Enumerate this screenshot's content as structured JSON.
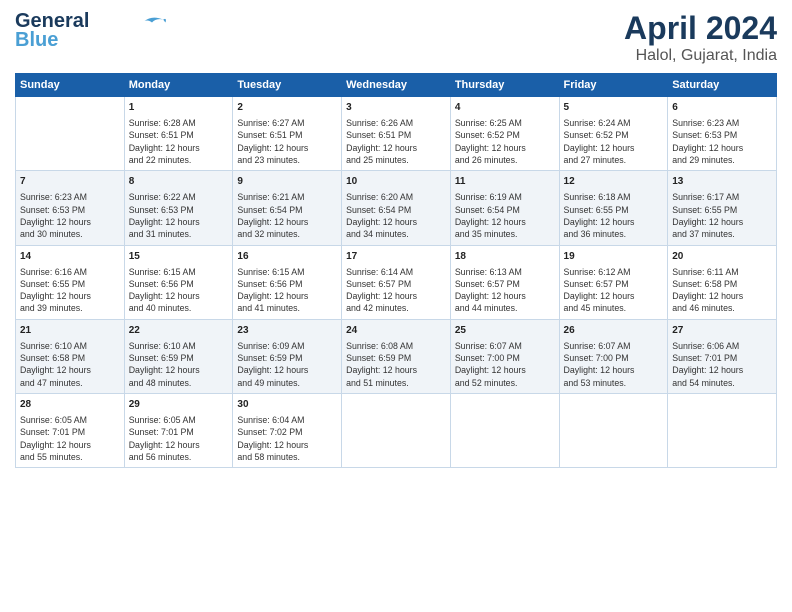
{
  "header": {
    "logo_line1": "General",
    "logo_line2": "Blue",
    "title": "April 2024",
    "subtitle": "Halol, Gujarat, India"
  },
  "days_of_week": [
    "Sunday",
    "Monday",
    "Tuesday",
    "Wednesday",
    "Thursday",
    "Friday",
    "Saturday"
  ],
  "weeks": [
    [
      {
        "day": "",
        "info": ""
      },
      {
        "day": "1",
        "info": "Sunrise: 6:28 AM\nSunset: 6:51 PM\nDaylight: 12 hours\nand 22 minutes."
      },
      {
        "day": "2",
        "info": "Sunrise: 6:27 AM\nSunset: 6:51 PM\nDaylight: 12 hours\nand 23 minutes."
      },
      {
        "day": "3",
        "info": "Sunrise: 6:26 AM\nSunset: 6:51 PM\nDaylight: 12 hours\nand 25 minutes."
      },
      {
        "day": "4",
        "info": "Sunrise: 6:25 AM\nSunset: 6:52 PM\nDaylight: 12 hours\nand 26 minutes."
      },
      {
        "day": "5",
        "info": "Sunrise: 6:24 AM\nSunset: 6:52 PM\nDaylight: 12 hours\nand 27 minutes."
      },
      {
        "day": "6",
        "info": "Sunrise: 6:23 AM\nSunset: 6:53 PM\nDaylight: 12 hours\nand 29 minutes."
      }
    ],
    [
      {
        "day": "7",
        "info": "Sunrise: 6:23 AM\nSunset: 6:53 PM\nDaylight: 12 hours\nand 30 minutes."
      },
      {
        "day": "8",
        "info": "Sunrise: 6:22 AM\nSunset: 6:53 PM\nDaylight: 12 hours\nand 31 minutes."
      },
      {
        "day": "9",
        "info": "Sunrise: 6:21 AM\nSunset: 6:54 PM\nDaylight: 12 hours\nand 32 minutes."
      },
      {
        "day": "10",
        "info": "Sunrise: 6:20 AM\nSunset: 6:54 PM\nDaylight: 12 hours\nand 34 minutes."
      },
      {
        "day": "11",
        "info": "Sunrise: 6:19 AM\nSunset: 6:54 PM\nDaylight: 12 hours\nand 35 minutes."
      },
      {
        "day": "12",
        "info": "Sunrise: 6:18 AM\nSunset: 6:55 PM\nDaylight: 12 hours\nand 36 minutes."
      },
      {
        "day": "13",
        "info": "Sunrise: 6:17 AM\nSunset: 6:55 PM\nDaylight: 12 hours\nand 37 minutes."
      }
    ],
    [
      {
        "day": "14",
        "info": "Sunrise: 6:16 AM\nSunset: 6:55 PM\nDaylight: 12 hours\nand 39 minutes."
      },
      {
        "day": "15",
        "info": "Sunrise: 6:15 AM\nSunset: 6:56 PM\nDaylight: 12 hours\nand 40 minutes."
      },
      {
        "day": "16",
        "info": "Sunrise: 6:15 AM\nSunset: 6:56 PM\nDaylight: 12 hours\nand 41 minutes."
      },
      {
        "day": "17",
        "info": "Sunrise: 6:14 AM\nSunset: 6:57 PM\nDaylight: 12 hours\nand 42 minutes."
      },
      {
        "day": "18",
        "info": "Sunrise: 6:13 AM\nSunset: 6:57 PM\nDaylight: 12 hours\nand 44 minutes."
      },
      {
        "day": "19",
        "info": "Sunrise: 6:12 AM\nSunset: 6:57 PM\nDaylight: 12 hours\nand 45 minutes."
      },
      {
        "day": "20",
        "info": "Sunrise: 6:11 AM\nSunset: 6:58 PM\nDaylight: 12 hours\nand 46 minutes."
      }
    ],
    [
      {
        "day": "21",
        "info": "Sunrise: 6:10 AM\nSunset: 6:58 PM\nDaylight: 12 hours\nand 47 minutes."
      },
      {
        "day": "22",
        "info": "Sunrise: 6:10 AM\nSunset: 6:59 PM\nDaylight: 12 hours\nand 48 minutes."
      },
      {
        "day": "23",
        "info": "Sunrise: 6:09 AM\nSunset: 6:59 PM\nDaylight: 12 hours\nand 49 minutes."
      },
      {
        "day": "24",
        "info": "Sunrise: 6:08 AM\nSunset: 6:59 PM\nDaylight: 12 hours\nand 51 minutes."
      },
      {
        "day": "25",
        "info": "Sunrise: 6:07 AM\nSunset: 7:00 PM\nDaylight: 12 hours\nand 52 minutes."
      },
      {
        "day": "26",
        "info": "Sunrise: 6:07 AM\nSunset: 7:00 PM\nDaylight: 12 hours\nand 53 minutes."
      },
      {
        "day": "27",
        "info": "Sunrise: 6:06 AM\nSunset: 7:01 PM\nDaylight: 12 hours\nand 54 minutes."
      }
    ],
    [
      {
        "day": "28",
        "info": "Sunrise: 6:05 AM\nSunset: 7:01 PM\nDaylight: 12 hours\nand 55 minutes."
      },
      {
        "day": "29",
        "info": "Sunrise: 6:05 AM\nSunset: 7:01 PM\nDaylight: 12 hours\nand 56 minutes."
      },
      {
        "day": "30",
        "info": "Sunrise: 6:04 AM\nSunset: 7:02 PM\nDaylight: 12 hours\nand 58 minutes."
      },
      {
        "day": "",
        "info": ""
      },
      {
        "day": "",
        "info": ""
      },
      {
        "day": "",
        "info": ""
      },
      {
        "day": "",
        "info": ""
      }
    ]
  ]
}
